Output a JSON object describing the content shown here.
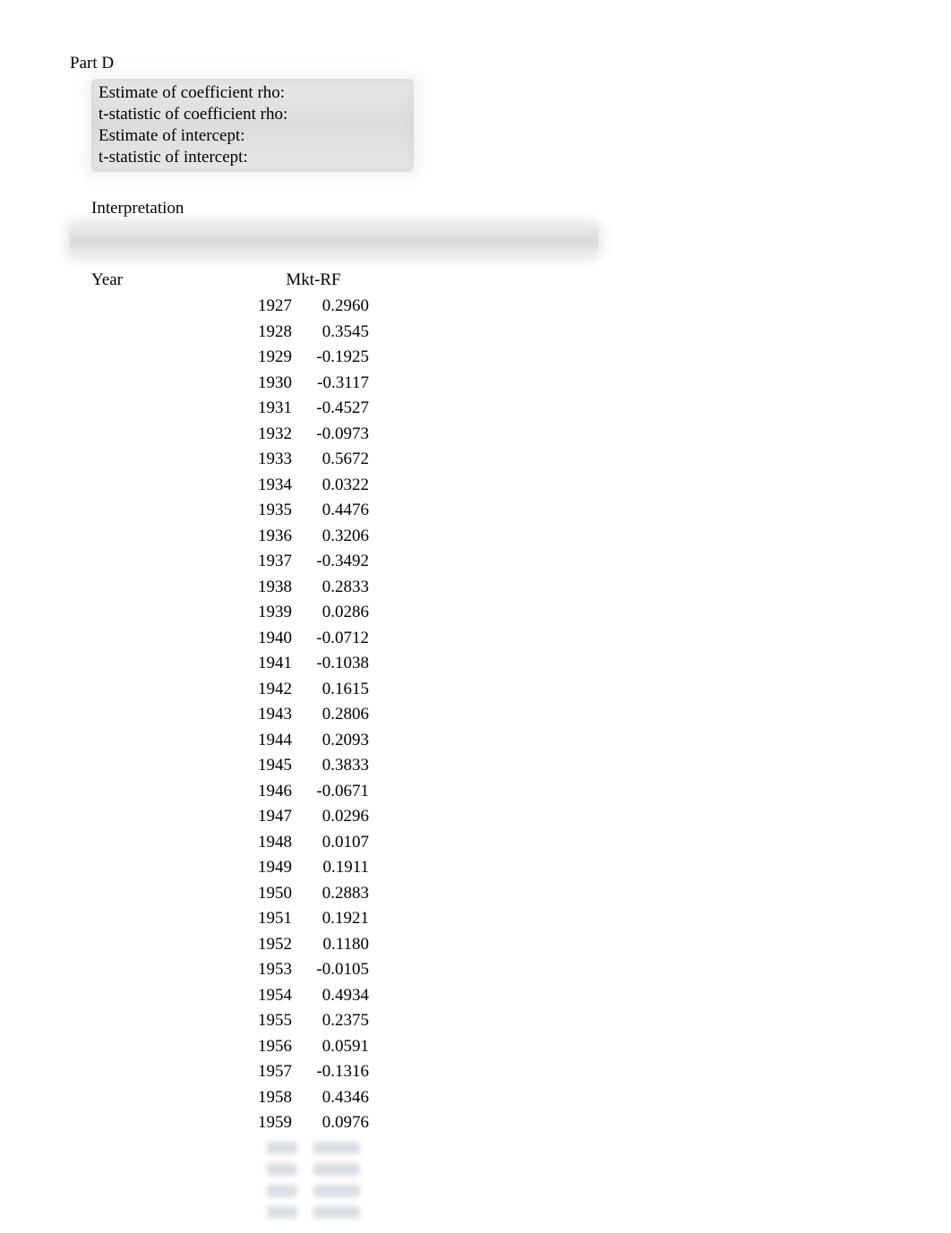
{
  "part_label": "Part D",
  "fields": {
    "rho_coef_label": "Estimate of coefficient rho:",
    "rho_tstat_label": "t-statistic of coefficient rho:",
    "intercept_est_label": "Estimate of intercept:",
    "intercept_tstat_label": "t-statistic of intercept:"
  },
  "interpretation_label": "Interpretation",
  "table": {
    "col_year": "Year",
    "col_mkt": "Mkt-RF",
    "rows": [
      {
        "year": "1927",
        "val": "0.2960"
      },
      {
        "year": "1928",
        "val": "0.3545"
      },
      {
        "year": "1929",
        "val": "-0.1925"
      },
      {
        "year": "1930",
        "val": "-0.3117"
      },
      {
        "year": "1931",
        "val": "-0.4527"
      },
      {
        "year": "1932",
        "val": "-0.0973"
      },
      {
        "year": "1933",
        "val": "0.5672"
      },
      {
        "year": "1934",
        "val": "0.0322"
      },
      {
        "year": "1935",
        "val": "0.4476"
      },
      {
        "year": "1936",
        "val": "0.3206"
      },
      {
        "year": "1937",
        "val": "-0.3492"
      },
      {
        "year": "1938",
        "val": "0.2833"
      },
      {
        "year": "1939",
        "val": "0.0286"
      },
      {
        "year": "1940",
        "val": "-0.0712"
      },
      {
        "year": "1941",
        "val": "-0.1038"
      },
      {
        "year": "1942",
        "val": "0.1615"
      },
      {
        "year": "1943",
        "val": "0.2806"
      },
      {
        "year": "1944",
        "val": "0.2093"
      },
      {
        "year": "1945",
        "val": "0.3833"
      },
      {
        "year": "1946",
        "val": "-0.0671"
      },
      {
        "year": "1947",
        "val": "0.0296"
      },
      {
        "year": "1948",
        "val": "0.0107"
      },
      {
        "year": "1949",
        "val": "0.1911"
      },
      {
        "year": "1950",
        "val": "0.2883"
      },
      {
        "year": "1951",
        "val": "0.1921"
      },
      {
        "year": "1952",
        "val": "0.1180"
      },
      {
        "year": "1953",
        "val": "-0.0105"
      },
      {
        "year": "1954",
        "val": "0.4934"
      },
      {
        "year": "1955",
        "val": "0.2375"
      },
      {
        "year": "1956",
        "val": "0.0591"
      },
      {
        "year": "1957",
        "val": "-0.1316"
      },
      {
        "year": "1958",
        "val": "0.4346"
      },
      {
        "year": "1959",
        "val": "0.0976"
      }
    ]
  }
}
